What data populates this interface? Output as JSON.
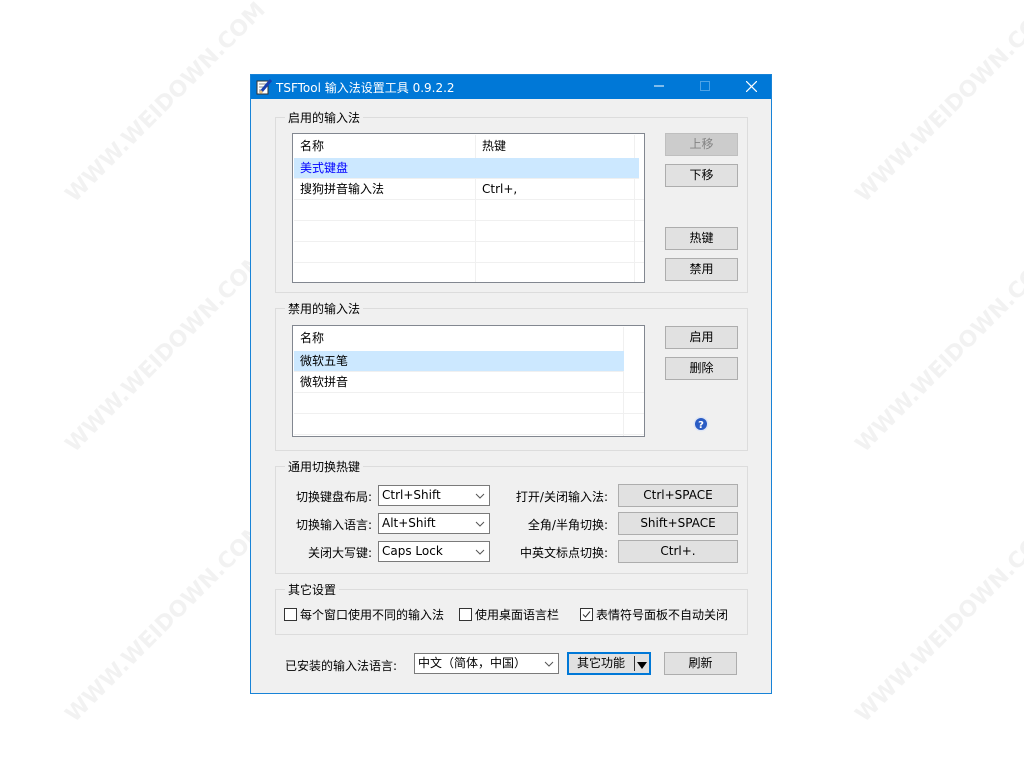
{
  "window": {
    "title": "TSFTool 输入法设置工具 0.9.2.2",
    "icon": "notepad-pen-icon",
    "controls": {
      "minimize": "—",
      "maximize": "☐",
      "close": "✕"
    }
  },
  "enabled_group": {
    "label": "启用的输入法",
    "columns": [
      "名称",
      "热键"
    ],
    "rows": [
      {
        "name": "美式键盘",
        "hotkey": "",
        "selected": true
      },
      {
        "name": "搜狗拼音输入法",
        "hotkey": "Ctrl+,",
        "selected": false
      }
    ],
    "buttons": {
      "move_up": "上移",
      "move_down": "下移",
      "hotkey": "热键",
      "disable": "禁用"
    }
  },
  "disabled_group": {
    "label": "禁用的输入法",
    "columns": [
      "名称"
    ],
    "rows": [
      {
        "name": "微软五笔",
        "selected": true
      },
      {
        "name": "微软拼音",
        "selected": false
      }
    ],
    "buttons": {
      "enable": "启用",
      "delete": "删除"
    },
    "help_icon": "help-question-icon"
  },
  "hotkey_group": {
    "label": "通用切换热键",
    "switch_layout_label": "切换键盘布局:",
    "switch_layout_value": "Ctrl+Shift",
    "switch_language_label": "切换输入语言:",
    "switch_language_value": "Alt+Shift",
    "capslock_label": "关闭大写键:",
    "capslock_value": "Caps Lock",
    "toggle_ime_label": "打开/关闭输入法:",
    "toggle_ime_value": "Ctrl+SPACE",
    "fullhalf_label": "全角/半角切换:",
    "fullhalf_value": "Shift+SPACE",
    "punct_label": "中英文标点切换:",
    "punct_value": "Ctrl+."
  },
  "other_group": {
    "label": "其它设置",
    "checkboxes": [
      {
        "label": "每个窗口使用不同的输入法",
        "checked": false
      },
      {
        "label": "使用桌面语言栏",
        "checked": false
      },
      {
        "label": "表情符号面板不自动关闭",
        "checked": true
      }
    ]
  },
  "footer": {
    "installed_lang_label": "已安装的输入法语言:",
    "installed_lang_value": "中文（简体，中国）",
    "other_functions": "其它功能",
    "refresh": "刷新"
  },
  "watermark_text": "WWW.WEIDOWN.COM"
}
